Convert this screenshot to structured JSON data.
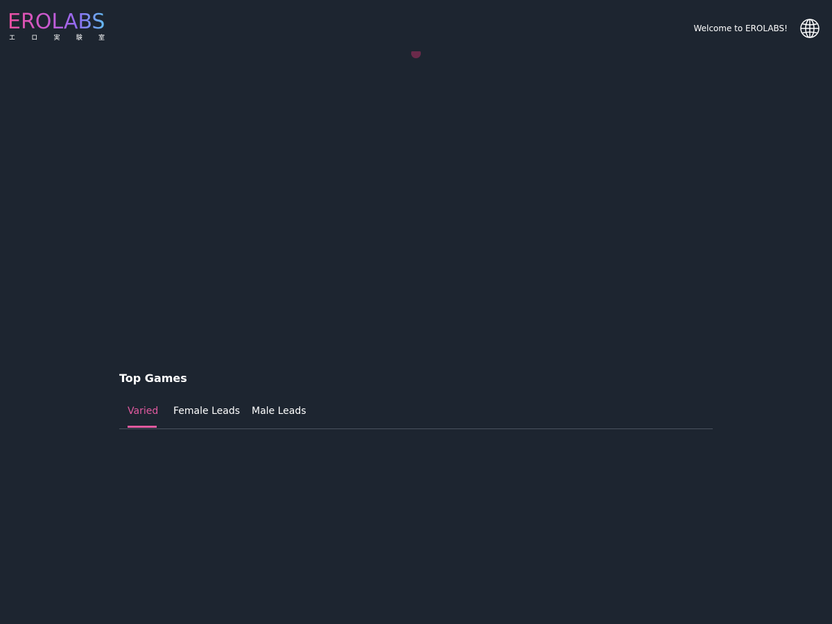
{
  "header": {
    "logo": {
      "wordmark": "EROLABS",
      "subtitle_chars": [
        "エ",
        "ロ",
        "実",
        "験",
        "室"
      ]
    },
    "welcome_text": "Welcome to EROLABS!",
    "language_icon": "globe-icon"
  },
  "top_games": {
    "title": "Top Games",
    "tabs": [
      {
        "label": "Varied",
        "active": true
      },
      {
        "label": "Female Leads",
        "active": false
      },
      {
        "label": "Male Leads",
        "active": false
      }
    ]
  },
  "colors": {
    "background": "#1d2530",
    "accent": "#e25aa0",
    "logo_gradient": [
      "#ea4f9e",
      "#c45bd6",
      "#8e6cf2",
      "#5ec4f1"
    ],
    "divider": "#4a5360"
  }
}
